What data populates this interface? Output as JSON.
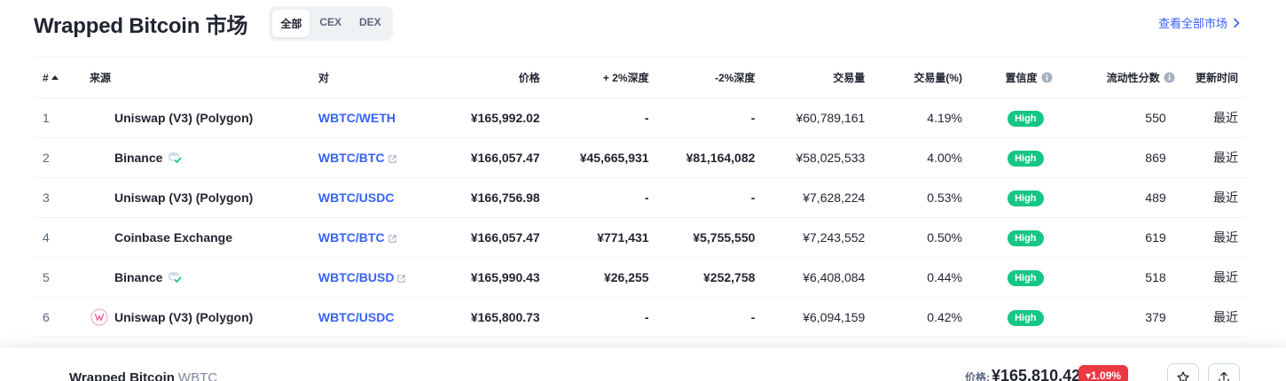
{
  "header": {
    "title": "Wrapped Bitcoin 市场",
    "filters": [
      {
        "label": "全部",
        "active": true
      },
      {
        "label": "CEX",
        "active": false
      },
      {
        "label": "DEX",
        "active": false
      }
    ],
    "view_all": "查看全部市场"
  },
  "table": {
    "columns": {
      "rank": "#",
      "source": "来源",
      "pair": "对",
      "price": "价格",
      "depth_plus": "+ 2%深度",
      "depth_minus": "-2%深度",
      "volume": "交易量",
      "volume_pct": "交易量(%)",
      "confidence": "置信度",
      "liquidity": "流动性分数",
      "updated": "更新时间"
    },
    "rows": [
      {
        "rank": "1",
        "source": "Uniswap (V3) (Polygon)",
        "logo": "",
        "pair": "WBTC/WETH",
        "external": false,
        "price": "¥165,992.02",
        "depth_plus": "-",
        "depth_minus": "-",
        "volume": "¥60,789,161",
        "volume_pct": "4.19%",
        "confidence": "High",
        "liquidity": "550",
        "updated": "最近"
      },
      {
        "rank": "2",
        "source": "Binance",
        "logo": "",
        "verified": true,
        "pair": "WBTC/BTC",
        "external": true,
        "price": "¥166,057.47",
        "depth_plus": "¥45,665,931",
        "depth_minus": "¥81,164,082",
        "volume": "¥58,025,533",
        "volume_pct": "4.00%",
        "confidence": "High",
        "liquidity": "869",
        "updated": "最近"
      },
      {
        "rank": "3",
        "source": "Uniswap (V3) (Polygon)",
        "logo": "",
        "pair": "WBTC/USDC",
        "external": false,
        "price": "¥166,756.98",
        "depth_plus": "-",
        "depth_minus": "-",
        "volume": "¥7,628,224",
        "volume_pct": "0.53%",
        "confidence": "High",
        "liquidity": "489",
        "updated": "最近"
      },
      {
        "rank": "4",
        "source": "Coinbase Exchange",
        "logo": "",
        "pair": "WBTC/BTC",
        "external": true,
        "price": "¥166,057.47",
        "depth_plus": "¥771,431",
        "depth_minus": "¥5,755,550",
        "volume": "¥7,243,552",
        "volume_pct": "0.50%",
        "confidence": "High",
        "liquidity": "619",
        "updated": "最近"
      },
      {
        "rank": "5",
        "source": "Binance",
        "logo": "",
        "verified": true,
        "pair": "WBTC/BUSD",
        "external": true,
        "price": "¥165,990.43",
        "depth_plus": "¥26,255",
        "depth_minus": "¥252,758",
        "volume": "¥6,408,084",
        "volume_pct": "0.44%",
        "confidence": "High",
        "liquidity": "518",
        "updated": "最近"
      },
      {
        "rank": "6",
        "source": "Uniswap (V3) (Polygon)",
        "logo": "uniswap",
        "pair": "WBTC/USDC",
        "external": false,
        "price": "¥165,800.73",
        "depth_plus": "-",
        "depth_minus": "-",
        "volume": "¥6,094,159",
        "volume_pct": "0.42%",
        "confidence": "High",
        "liquidity": "379",
        "updated": "最近"
      }
    ]
  },
  "bottom_bar": {
    "name": "Wrapped Bitcoin",
    "symbol": "WBTC",
    "price_label": "价格:",
    "price": "¥165,810.42",
    "change": "▾1.09%"
  },
  "colors": {
    "accent": "#3861fb",
    "high": "#16c784",
    "down": "#ea3943"
  }
}
